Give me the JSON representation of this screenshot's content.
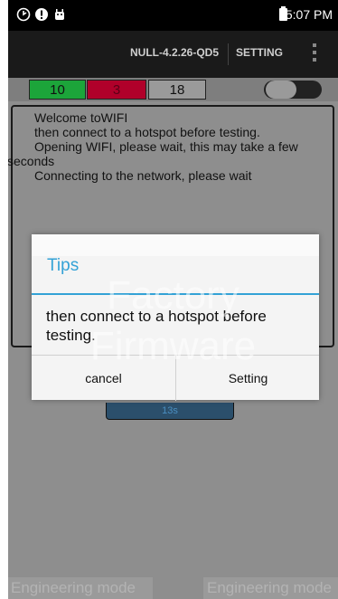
{
  "status_bar": {
    "time": "5:07 PM",
    "icons": [
      "clock-icon",
      "alert-icon",
      "android-icon",
      "battery-icon"
    ]
  },
  "action_bar": {
    "title": "NULL-4.2.26-QD5",
    "setting_label": "SETTING",
    "menu_icon": "overflow-menu-icon"
  },
  "counters": {
    "pass": "10",
    "fail": "3",
    "total": "18",
    "colors": {
      "pass": "#1ca53a",
      "fail": "#b0002a",
      "total": "#9a9a9a"
    }
  },
  "log": {
    "lines": [
      "Welcome toWIFI",
      "then connect to a hotspot before testing.",
      "Opening WIFI, please wait, this may take a few",
      "seconds",
      "Connecting to the network, please wait"
    ]
  },
  "timer": {
    "text": "13s"
  },
  "dialog": {
    "title": "Tips",
    "message": "then connect to a hotspot before testing.",
    "cancel_label": "cancel",
    "confirm_label": "Setting",
    "accent_color": "#33a2d6"
  },
  "watermark": {
    "line1": "Factory",
    "line2": "Firmware"
  },
  "footer": {
    "left_label": "Engineering mode",
    "right_label": "Engineering mode"
  }
}
